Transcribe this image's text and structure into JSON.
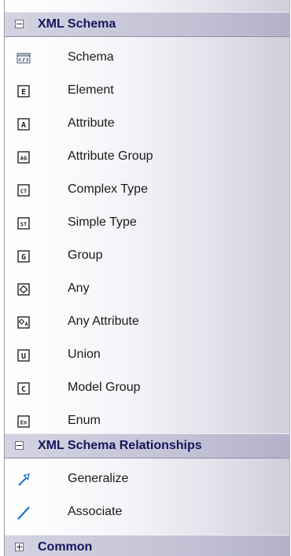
{
  "sections": [
    {
      "title": "XML Schema",
      "expanded": true,
      "items": [
        {
          "label": "Schema",
          "icon": "schema-icon"
        },
        {
          "label": "Element",
          "icon": "element-icon",
          "glyph": "E"
        },
        {
          "label": "Attribute",
          "icon": "attribute-icon",
          "glyph": "A"
        },
        {
          "label": "Attribute Group",
          "icon": "attribute-group-icon",
          "glyph": "AG"
        },
        {
          "label": "Complex Type",
          "icon": "complex-type-icon",
          "glyph": "CT"
        },
        {
          "label": "Simple Type",
          "icon": "simple-type-icon",
          "glyph": "ST"
        },
        {
          "label": "Group",
          "icon": "group-icon",
          "glyph": "G"
        },
        {
          "label": "Any",
          "icon": "any-icon"
        },
        {
          "label": "Any Attribute",
          "icon": "any-attribute-icon"
        },
        {
          "label": "Union",
          "icon": "union-icon",
          "glyph": "U"
        },
        {
          "label": "Model Group",
          "icon": "model-group-icon",
          "glyph": "C"
        },
        {
          "label": "Enum",
          "icon": "enum-icon",
          "glyph": "En"
        }
      ]
    },
    {
      "title": "XML Schema Relationships",
      "expanded": true,
      "items": [
        {
          "label": "Generalize",
          "icon": "generalize-arrow-icon"
        },
        {
          "label": "Associate",
          "icon": "associate-line-icon"
        }
      ]
    },
    {
      "title": "Common",
      "expanded": false,
      "items": []
    }
  ],
  "colors": {
    "header_text": "#15155c",
    "item_text": "#1a1a1a",
    "icon_blue": "#1e6fd0"
  }
}
